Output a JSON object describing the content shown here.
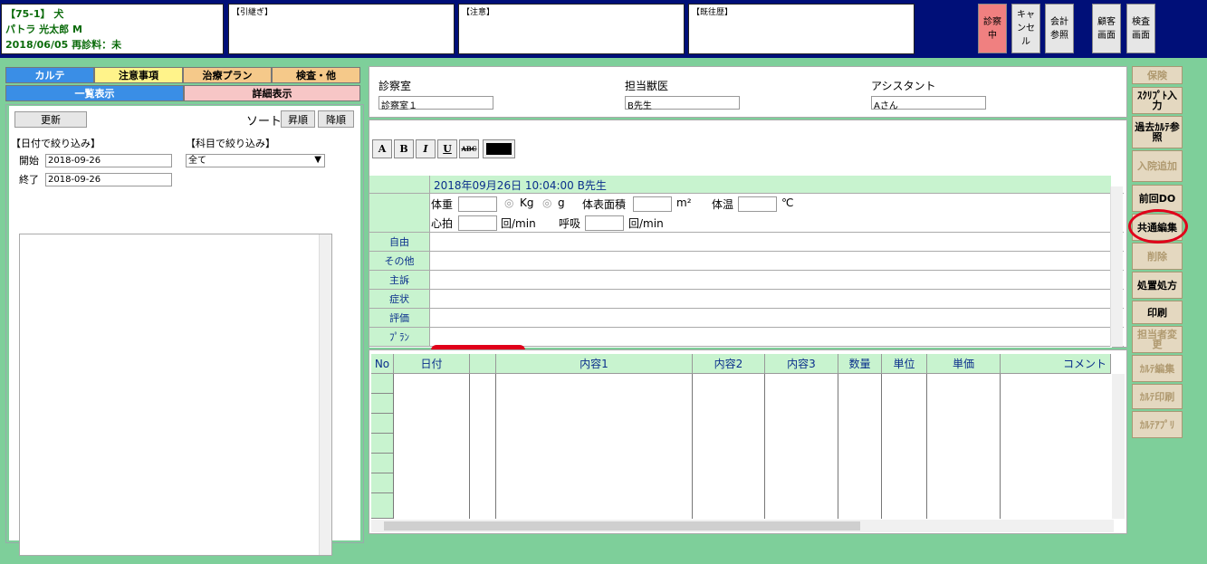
{
  "header": {
    "patient": {
      "line1": "【75-1】 犬",
      "line2": "パトラ 光太郎 M",
      "line3": "2018/06/05 再診料：未"
    },
    "memos": [
      {
        "title": "【引継ぎ】"
      },
      {
        "title": "【注意】"
      },
      {
        "title": "【既往歴】"
      }
    ],
    "buttons": {
      "shinsatsu": "診察中",
      "cancel": "キャンセル",
      "kaikei": "会計参照",
      "kokyaku": "顧客画面",
      "kensa": "検査画面"
    }
  },
  "left": {
    "tabs_row1": [
      "カルテ",
      "注意事項",
      "治療プラン",
      "検査・他"
    ],
    "tabs_row2": [
      "一覧表示",
      "詳細表示"
    ],
    "refresh": "更新",
    "sort_label": "ソート",
    "sort_asc": "昇順",
    "sort_desc": "降順",
    "date_filter_label": "【日付で絞り込み】",
    "subject_filter_label": "【科目で絞り込み】",
    "start_label": "開始",
    "start_value": "2018-09-26",
    "end_label": "終了",
    "end_value": "2018-09-26",
    "subject_value": "全て"
  },
  "staff": {
    "room_label": "診察室",
    "room_value": "診察室１",
    "doctor_label": "担当獣医",
    "doctor_value": "B先生",
    "assistant_label": "アシスタント",
    "assistant_value": "Aさん"
  },
  "toolbar": {
    "a": "A",
    "b": "B",
    "i": "I",
    "u": "U",
    "abc": "ABC"
  },
  "record": {
    "header": "2018年09月26日 10:04:00 B先生",
    "weight_label": "体重",
    "kg": "Kg",
    "g": "g",
    "bsa_label": "体表面積",
    "bsa_unit": "m²",
    "temp_label": "体温",
    "temp_unit": "℃",
    "pulse_label": "心拍",
    "pulse_unit": "回/min",
    "resp_label": "呼吸",
    "resp_unit": "回/min",
    "rows": [
      "自由",
      "その他",
      "主訴",
      "症状",
      "評価",
      "ﾌﾟﾗﾝ"
    ]
  },
  "order_columns": [
    "No",
    "日付",
    "",
    "内容1",
    "内容2",
    "内容3",
    "数量",
    "単位",
    "単価",
    "コメント"
  ],
  "side_buttons": [
    {
      "label": "保険",
      "enabled": false
    },
    {
      "label": "ｽｸﾘﾌﾟﾄ入力",
      "enabled": true
    },
    {
      "label": "過去ｶﾙﾃ参照",
      "enabled": true
    },
    {
      "label": "入院追加",
      "enabled": false
    },
    {
      "label": "前回DO",
      "enabled": true
    },
    {
      "label": "共通編集",
      "enabled": true
    },
    {
      "label": "削除",
      "enabled": false
    },
    {
      "label": "処置処方",
      "enabled": true
    },
    {
      "label": "印刷",
      "enabled": true
    },
    {
      "label": "担当者変更",
      "enabled": false
    },
    {
      "label": "ｶﾙﾃ編集",
      "enabled": false
    },
    {
      "label": "ｶﾙﾃ印刷",
      "enabled": false
    },
    {
      "label": "ｶﾙﾃｱﾌﾟﾘ",
      "enabled": false
    }
  ],
  "colors": {
    "header_bg": "#000f78",
    "page_bg": "#7ecf9a",
    "highlight": "#e0001a"
  }
}
